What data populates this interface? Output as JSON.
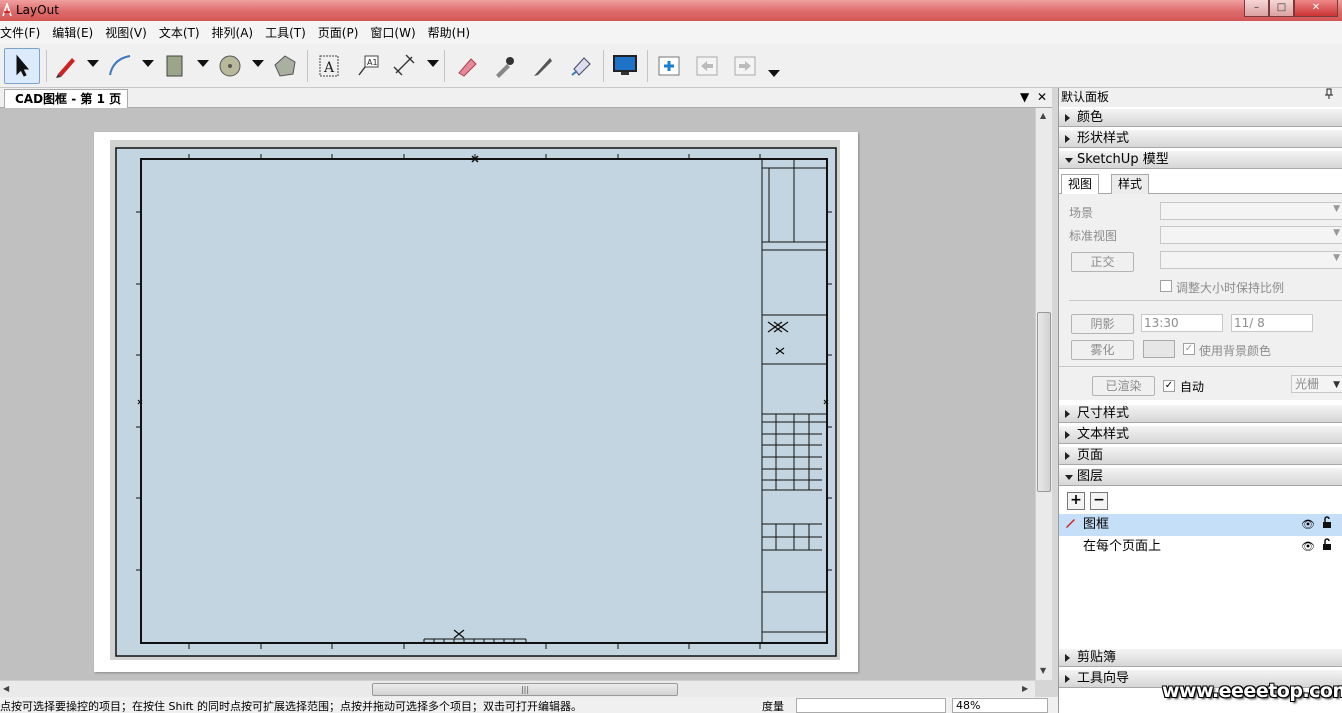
{
  "window": {
    "title": "LayOut",
    "app_icon": "layout-app-icon",
    "minimize": "–",
    "maximize": "□",
    "close": "✕"
  },
  "menu": [
    "文件(F)",
    "编辑(E)",
    "视图(V)",
    "文本(T)",
    "排列(A)",
    "工具(T)",
    "页面(P)",
    "窗口(W)",
    "帮助(H)"
  ],
  "toolbar": {
    "tools": [
      "select-tool",
      "pencil-tool",
      "arc-tool",
      "rectangle-tool",
      "circle-tool",
      "polygon-tool",
      "text-tool",
      "label-tool",
      "dimension-tool",
      "eraser-tool",
      "eyedropper-tool",
      "split-tool",
      "join-tool",
      "presentation-tool",
      "add-page-tool",
      "previous-page-tool",
      "next-page-tool"
    ]
  },
  "document": {
    "tab_label": "CAD图框 - 第 1 页",
    "tab_menu": "▼",
    "tab_close": "✕"
  },
  "statusbar": {
    "message": "点按可选择要操控的项目；在按住 Shift 的同时点按可扩展选择范围；点按并拖动可选择多个项目；双击可打开编辑器。",
    "measure_label": "度量",
    "zoom": "48%"
  },
  "panel": {
    "title": "默认面板",
    "pin": "📌",
    "sections": {
      "color": "颜色",
      "shape_style": "形状样式",
      "sketchup_model": "SketchUp 模型",
      "dimension_style": "尺寸样式",
      "text_style": "文本样式",
      "pages": "页面",
      "layers": "图层",
      "scrapbooks": "剪贴簿",
      "instructor": "工具向导"
    },
    "sketchup": {
      "tab_view": "视图",
      "tab_style": "样式",
      "scene_label": "场景",
      "standard_view_label": "标准视图",
      "ortho_button": "正交",
      "preserve_scale_label": "调整大小时保持比例",
      "shadows_button": "阴影",
      "shadow_time": "13:30",
      "shadow_date": "11/ 8",
      "fog_button": "雾化",
      "use_bg_color_label": "使用背景颜色",
      "rendered_button": "已渲染",
      "auto_label": "自动",
      "raster_option": "光栅"
    },
    "layers": {
      "add": "+",
      "remove": "−",
      "items": [
        {
          "name": "图框",
          "selected": true
        },
        {
          "name": "在每个页面上",
          "selected": false
        }
      ]
    }
  },
  "watermark": "www.eeeetop.com",
  "colors": {
    "titlebar": "#dd6a6a",
    "drawing_fill": "#c3d5e0",
    "canvas_bg": "#c0c0c0",
    "selection": "#c5dff9"
  }
}
